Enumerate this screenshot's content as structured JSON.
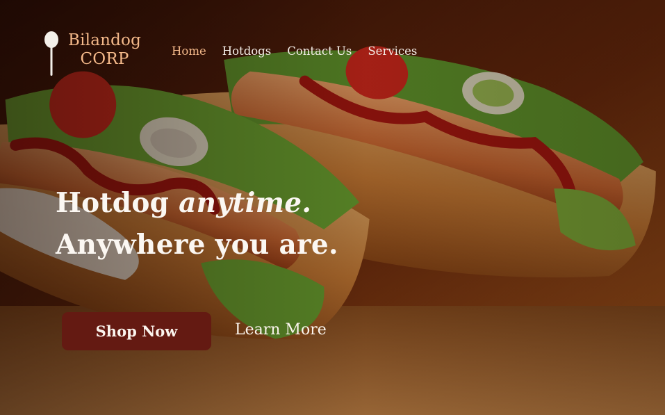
{
  "brand": {
    "line1": "Bilandog",
    "line2": "CORP",
    "icon": "hotdog-skewer-icon",
    "color": "#f4b98a"
  },
  "nav": {
    "items": [
      {
        "label": "Home",
        "active": true
      },
      {
        "label": "Hotdogs",
        "active": false
      },
      {
        "label": "Contact Us",
        "active": false
      },
      {
        "label": "Services",
        "active": false
      }
    ],
    "active_color": "#f4b98a"
  },
  "hero": {
    "headline_plain": "Hotdog ",
    "headline_emphasis": "anytime.",
    "headline_line2": "Anywhere you are.",
    "background": "hotdogs-photo"
  },
  "cta": {
    "primary_label": "Shop Now",
    "primary_color": "#641a12",
    "secondary_label": "Learn More"
  }
}
